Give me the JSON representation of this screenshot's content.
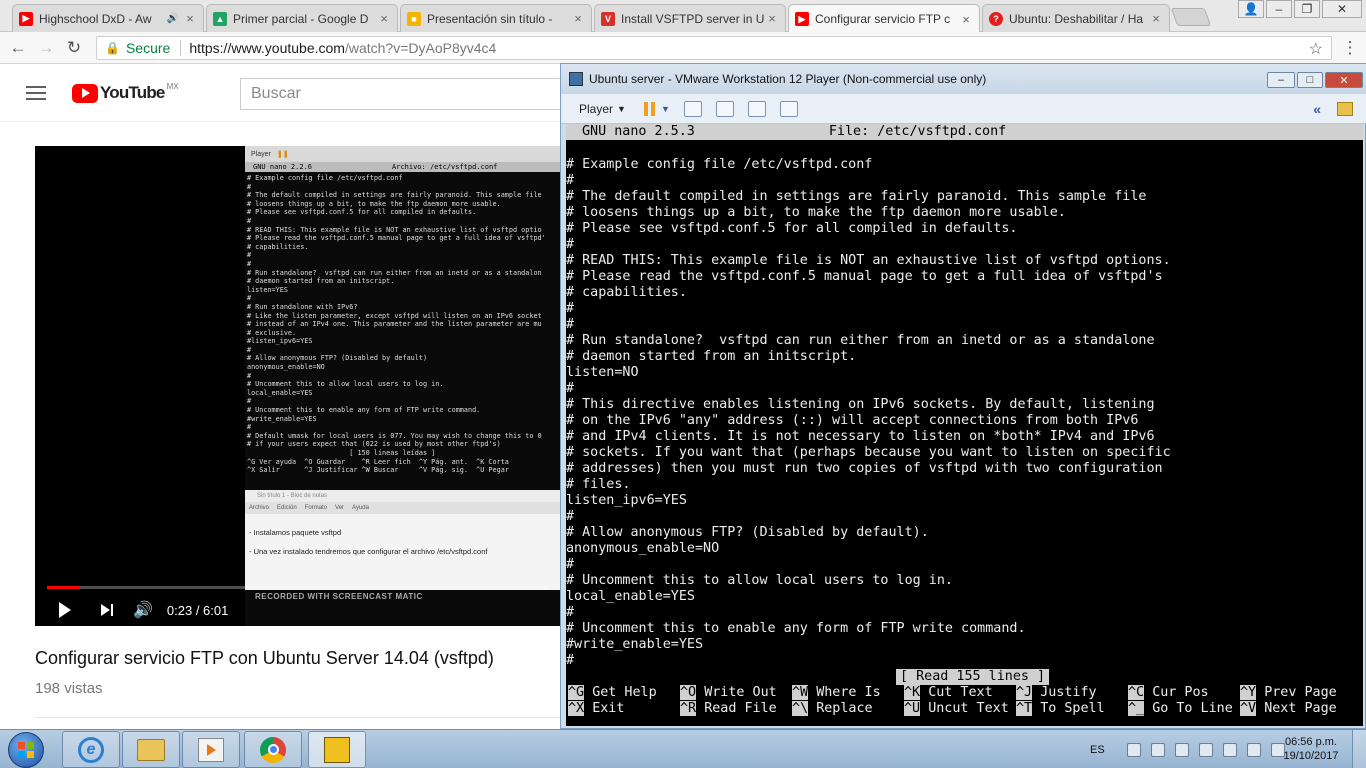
{
  "browser": {
    "tabs": [
      {
        "title": "Highschool DxD - Aw",
        "favicon_color": "#ff0000",
        "favicon": "youtube-icon"
      },
      {
        "title": "Primer parcial - Google D",
        "favicon_color": "#1fa463",
        "favicon": "drive-icon"
      },
      {
        "title": "Presentación sin título - ",
        "favicon_color": "#f4b400",
        "favicon": "slides-icon"
      },
      {
        "title": "Install VSFTPD server in U",
        "favicon_color": "#d6322c",
        "favicon": "site-icon"
      },
      {
        "title": "Configurar servicio FTP c",
        "favicon_color": "#ff0000",
        "favicon": "youtube-icon"
      },
      {
        "title": "Ubuntu: Deshabilitar / Ha",
        "favicon_color": "#e02020",
        "favicon": "question-icon"
      }
    ],
    "secure_label": "Secure",
    "url_host": "https://www.youtube.com",
    "url_path": "/watch?v=DyAoP8yv4c4"
  },
  "youtube": {
    "logo_word": "YouTube",
    "region": "MX",
    "search_placeholder": "Buscar",
    "video_title": "Configurar servicio FTP con Ubuntu Server 14.04 (vsftpd)",
    "views": "198 vistas",
    "time_display": "0:23 / 6:01",
    "progress": 0.064,
    "thumb": {
      "toolbar_label": "Player",
      "nano_version": "GNU nano 2.2.6",
      "nano_file": "Archivo: /etc/vsftpd.conf",
      "lines": "# Example config file /etc/vsftpd.conf\n#\n# The default compiled in settings are fairly paranoid. This sample file\n# loosens things up a bit, to make the ftp daemon more usable.\n# Please see vsftpd.conf.5 for all compiled in defaults.\n#\n# READ THIS: This example file is NOT an exhaustive list of vsftpd optio\n# Please read the vsftpd.conf.5 manual page to get a full idea of vsftpd'\n# capabilities.\n#\n#\n# Run standalone?  vsftpd can run either from an inetd or as a standalon\n# daemon started from an initscript.\nlisten=YES\n#\n# Run standalone with IPv6?\n# Like the listen parameter, except vsftpd will listen on an IPv6 socket\n# instead of an IPv4 one. This parameter and the listen parameter are mu\n# exclusive.\n#listen_ipv6=YES\n#\n# Allow anonymous FTP? (Disabled by default)\nanonymous_enable=NO\n#\n# Uncomment this to allow local users to log in.\nlocal_enable=YES\n#\n# Uncomment this to enable any form of FTP write command.\n#write_enable=YES\n#\n# Default umask for local users is 077. You may wish to change this to 0\n# if your users expect that (022 is used by most other ftpd's)\n                         [ 150 líneas leídas ]\n^G Ver ayuda  ^O Guardar    ^R Leer fich  ^Y Pág. ant.  ^K Corta\n^X Salir      ^J Justificar ^W Buscar     ^V Pág. sig.  ^U Pegar",
      "doc_window_title": "Sin título 1 - Bloc de notas",
      "doc_menu": [
        "Archivo",
        "Edición",
        "Formato",
        "Ver",
        "Ayuda"
      ],
      "doc_line1": "- Instalamos paquete vsftpd",
      "doc_line2": "- Una vez instalado tendremos que configurar el archivo /etc/vsftpd.conf",
      "watermark": "RECORDED WITH SCREENCAST MATIC"
    }
  },
  "vmware": {
    "window_title": "Ubuntu server - VMware Workstation 12 Player (Non-commercial use only)",
    "player_menu": "Player",
    "nano": {
      "version": "GNU nano 2.5.3",
      "file": "File: /etc/vsftpd.conf",
      "body": "\n# Example config file /etc/vsftpd.conf\n#\n# The default compiled in settings are fairly paranoid. This sample file\n# loosens things up a bit, to make the ftp daemon more usable.\n# Please see vsftpd.conf.5 for all compiled in defaults.\n#\n# READ THIS: This example file is NOT an exhaustive list of vsftpd options.\n# Please read the vsftpd.conf.5 manual page to get a full idea of vsftpd's\n# capabilities.\n#\n#\n# Run standalone?  vsftpd can run either from an inetd or as a standalone\n# daemon started from an initscript.\nlisten=NO\n#\n# This directive enables listening on IPv6 sockets. By default, listening\n# on the IPv6 \"any\" address (::) will accept connections from both IPv6\n# and IPv4 clients. It is not necessary to listen on *both* IPv4 and IPv6\n# sockets. If you want that (perhaps because you want to listen on specific\n# addresses) then you must run two copies of vsftpd with two configuration\n# files.\nlisten_ipv6=YES\n#\n# Allow anonymous FTP? (Disabled by default).\nanonymous_enable=NO\n#\n# Uncomment this to allow local users to log in.\nlocal_enable=YES\n#\n# Uncomment this to enable any form of FTP write command.\n#write_enable=YES\n#",
      "status": "[ Read 155 lines ]",
      "help": [
        {
          "key": "^G",
          "label": "Get Help"
        },
        {
          "key": "^O",
          "label": "Write Out"
        },
        {
          "key": "^W",
          "label": "Where Is"
        },
        {
          "key": "^K",
          "label": "Cut Text"
        },
        {
          "key": "^J",
          "label": "Justify"
        },
        {
          "key": "^C",
          "label": "Cur Pos"
        },
        {
          "key": "^Y",
          "label": "Prev Page"
        },
        {
          "key": "^X",
          "label": "Exit"
        },
        {
          "key": "^R",
          "label": "Read File"
        },
        {
          "key": "^\\",
          "label": "Replace"
        },
        {
          "key": "^U",
          "label": "Uncut Text"
        },
        {
          "key": "^T",
          "label": "To Spell"
        },
        {
          "key": "^_",
          "label": "Go To Line"
        },
        {
          "key": "^V",
          "label": "Next Page"
        }
      ]
    }
  },
  "taskbar": {
    "language": "ES",
    "time": "06:56 p.m.",
    "date": "19/10/2017"
  }
}
